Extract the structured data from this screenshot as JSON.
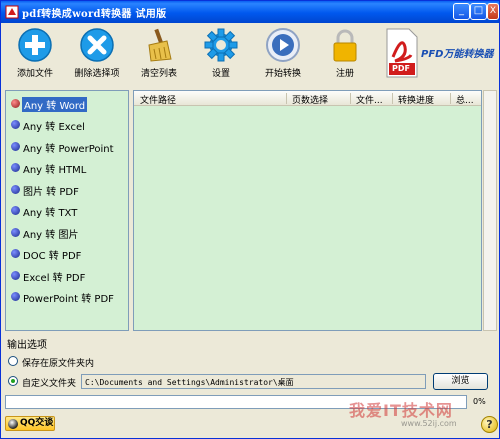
{
  "window": {
    "title": "pdf转换成word转换器 试用版",
    "controls": {
      "minimize": "_",
      "maximize": "□",
      "close": "X"
    }
  },
  "toolbar": {
    "items": [
      {
        "label": "添加文件",
        "icon": "plus-circle-icon",
        "color": "#1e9be8"
      },
      {
        "label": "删除选择项",
        "icon": "x-circle-icon",
        "color": "#1e9be8"
      },
      {
        "label": "清空列表",
        "icon": "broom-icon",
        "color": "#d6a21c"
      },
      {
        "label": "设置",
        "icon": "gear-icon",
        "color": "#1e9be8"
      },
      {
        "label": "开始转换",
        "icon": "play-icon",
        "color": "#3a6ebd"
      },
      {
        "label": "注册",
        "icon": "lock-icon",
        "color": "#f0b400"
      }
    ],
    "brand": {
      "text": "PFD万能转换器",
      "icon": "pdf-file-icon",
      "badge": "PDF",
      "badge_color": "#d11c1c"
    }
  },
  "conversions": {
    "items": [
      {
        "label": "Any 转 Word",
        "selected": true
      },
      {
        "label": "Any 转 Excel",
        "selected": false
      },
      {
        "label": "Any 转 PowerPoint",
        "selected": false
      },
      {
        "label": "Any 转 HTML",
        "selected": false
      },
      {
        "label": "图片 转 PDF",
        "selected": false
      },
      {
        "label": "Any 转 TXT",
        "selected": false
      },
      {
        "label": "Any 转 图片",
        "selected": false
      },
      {
        "label": "DOC 转 PDF",
        "selected": false
      },
      {
        "label": "Excel 转 PDF",
        "selected": false
      },
      {
        "label": "PowerPoint 转 PDF",
        "selected": false
      }
    ]
  },
  "file_table": {
    "columns": [
      "文件路径",
      "页数选择",
      "文件...",
      "转换进度",
      "总..."
    ],
    "rows": []
  },
  "output": {
    "title": "输出选项",
    "options": [
      {
        "label": "保存在原文件夹内",
        "checked": false
      },
      {
        "label": "自定义文件夹",
        "checked": true
      }
    ],
    "path": "C:\\Documents and Settings\\Administrator\\桌面",
    "browse_label": "浏览"
  },
  "progress": {
    "value": 0,
    "label": "0%"
  },
  "status": {
    "qq_label": "QQ交谈",
    "help": "?",
    "watermark": "我爱IT技术网",
    "watermark_url": "www.52ij.com"
  },
  "colors": {
    "titlebar": "#0058ee",
    "panel_bg": "#d4f0d4",
    "selected": "#316ac5",
    "progress": "#2fb12f"
  }
}
